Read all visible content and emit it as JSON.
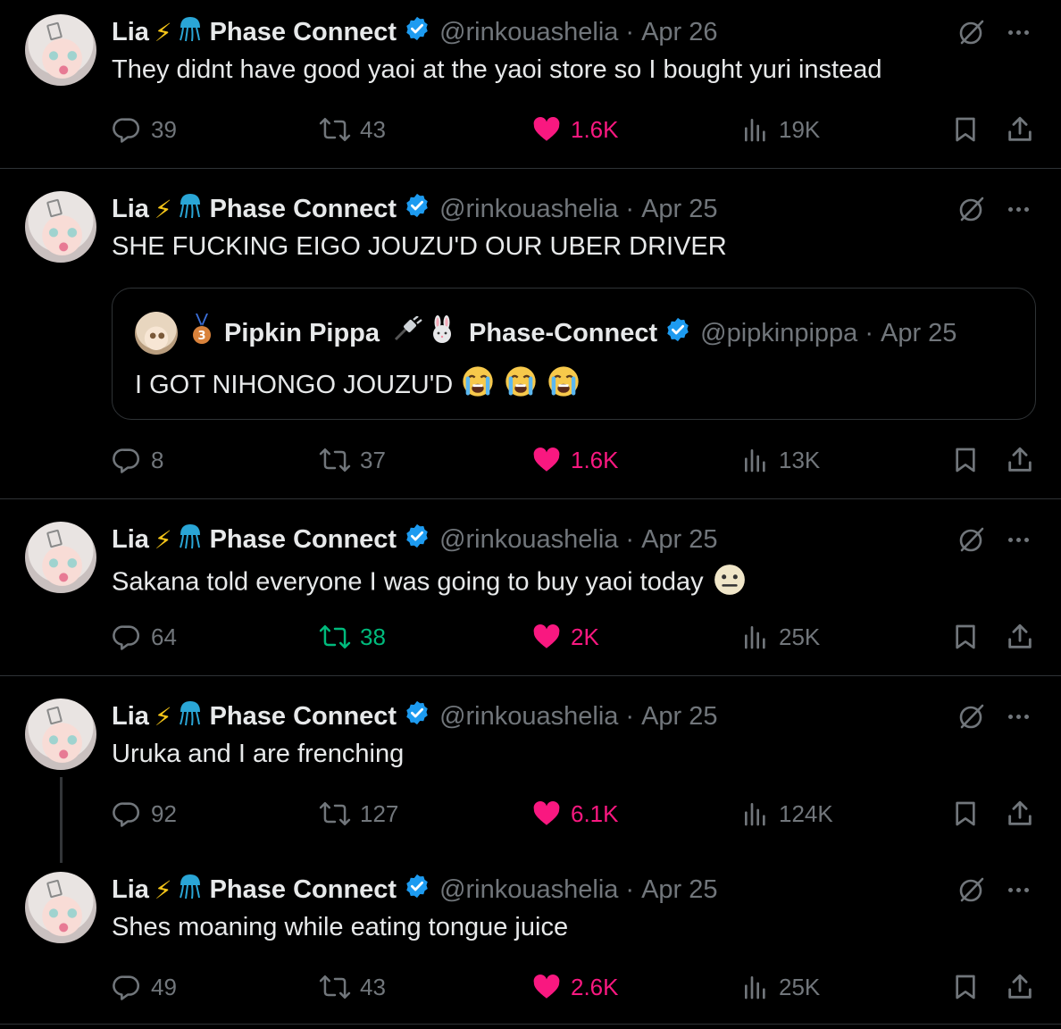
{
  "tweets": [
    {
      "name": "Lia",
      "org": "Phase Connect",
      "handle": "@rinkouashelia",
      "date": "Apr 26",
      "text": "They didnt have good yaoi at the yaoi store so I bought yuri instead",
      "replies": "39",
      "retweets": "43",
      "likes": "1.6K",
      "views": "19K"
    },
    {
      "name": "Lia",
      "org": "Phase Connect",
      "handle": "@rinkouashelia",
      "date": "Apr 25",
      "text": "SHE FUCKING EIGO JOUZU'D OUR UBER DRIVER",
      "quote": {
        "name": "Pipkin Pippa",
        "org": "Phase-Connect",
        "handle": "@pipkinpippa",
        "date": "Apr 25",
        "text": "I GOT NIHONGO JOUZU'D"
      },
      "replies": "8",
      "retweets": "37",
      "likes": "1.6K",
      "views": "13K"
    },
    {
      "name": "Lia",
      "org": "Phase Connect",
      "handle": "@rinkouashelia",
      "date": "Apr 25",
      "text": "Sakana told everyone I was going to buy yaoi today",
      "replies": "64",
      "retweets": "38",
      "likes": "2K",
      "views": "25K"
    },
    {
      "name": "Lia",
      "org": "Phase Connect",
      "handle": "@rinkouashelia",
      "date": "Apr 25",
      "text": "Uruka and I are frenching",
      "replies": "92",
      "retweets": "127",
      "likes": "6.1K",
      "views": "124K"
    },
    {
      "name": "Lia",
      "org": "Phase Connect",
      "handle": "@rinkouashelia",
      "date": "Apr 25",
      "text": "Shes moaning while eating tongue juice",
      "replies": "49",
      "retweets": "43",
      "likes": "2.6K",
      "views": "25K"
    }
  ],
  "separator": "·",
  "colors": {
    "background": "#000000",
    "text": "#e7e9ea",
    "muted": "#71767b",
    "like": "#f91880",
    "retweet_active": "#00ba7c",
    "verified": "#1d9bf0",
    "border": "#2f3336"
  },
  "icons": [
    "reply-icon",
    "retweet-icon",
    "heart-icon",
    "views-icon",
    "bookmark-icon",
    "share-icon",
    "grok-icon",
    "more-icon",
    "verified-icon"
  ]
}
